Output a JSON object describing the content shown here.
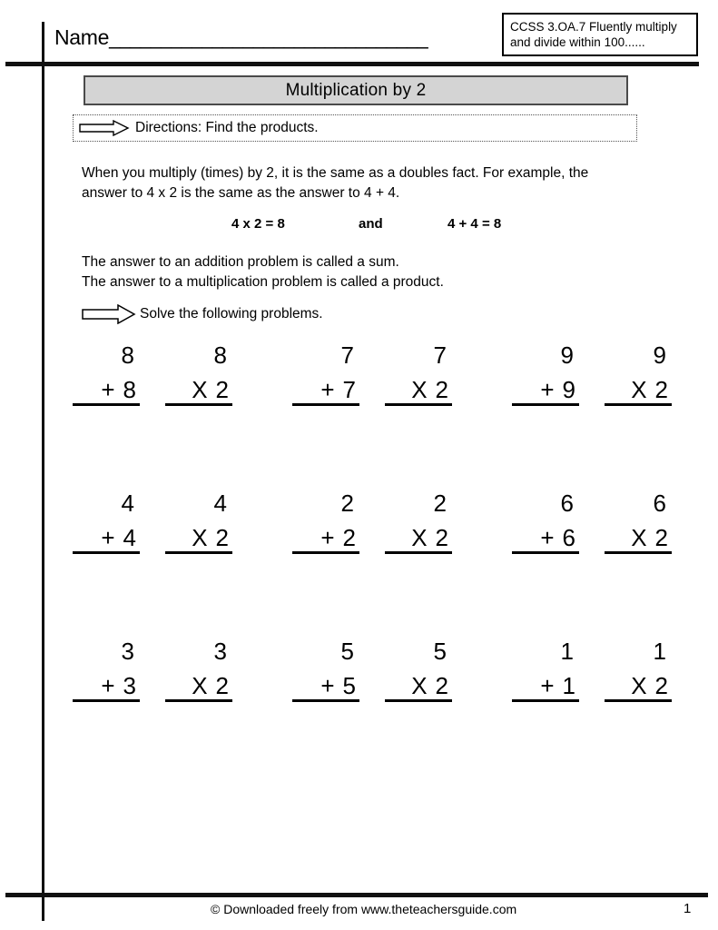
{
  "header": {
    "name_label": "Name",
    "name_blank": "_______________________________",
    "ccss_text": "CCSS 3.OA.7 Fluently multiply and divide   within 100......"
  },
  "title": {
    "banner": "Multiplication by 2"
  },
  "directions": {
    "arrow_icon": "right-arrow-icon",
    "text": "Directions: Find the products."
  },
  "lesson": {
    "intro": "When you multiply (times) by 2, it is the same as a doubles fact.  For example, the\nanswer to 4 x 2  is the same as the answer to 4 + 4.",
    "example_left": "4 x 2 = 8",
    "example_and": "and",
    "example_right": "4 + 4 = 8",
    "definitions": "The answer to an addition problem is called a sum.\nThe answer to a multiplication problem is called a product.",
    "solve_arrow_icon": "right-arrow-icon",
    "solve_text": "Solve the following problems."
  },
  "problems": {
    "rows": [
      {
        "pairs": [
          {
            "addition": {
              "top": "8",
              "op": "+",
              "bottom": "8"
            },
            "multiplication": {
              "top": "8",
              "op": "X",
              "bottom": "2"
            }
          },
          {
            "addition": {
              "top": "7",
              "op": "+",
              "bottom": "7"
            },
            "multiplication": {
              "top": "7",
              "op": "X",
              "bottom": "2"
            }
          },
          {
            "addition": {
              "top": "9",
              "op": "+",
              "bottom": "9"
            },
            "multiplication": {
              "top": "9",
              "op": "X",
              "bottom": "2"
            }
          }
        ]
      },
      {
        "pairs": [
          {
            "addition": {
              "top": "4",
              "op": "+",
              "bottom": "4"
            },
            "multiplication": {
              "top": "4",
              "op": "X",
              "bottom": "2"
            }
          },
          {
            "addition": {
              "top": "2",
              "op": "+",
              "bottom": "2"
            },
            "multiplication": {
              "top": "2",
              "op": "X",
              "bottom": "2"
            }
          },
          {
            "addition": {
              "top": "6",
              "op": "+",
              "bottom": "6"
            },
            "multiplication": {
              "top": "6",
              "op": "X",
              "bottom": "2"
            }
          }
        ]
      },
      {
        "pairs": [
          {
            "addition": {
              "top": "3",
              "op": "+",
              "bottom": "3"
            },
            "multiplication": {
              "top": "3",
              "op": "X",
              "bottom": "2"
            }
          },
          {
            "addition": {
              "top": "5",
              "op": "+",
              "bottom": "5"
            },
            "multiplication": {
              "top": "5",
              "op": "X",
              "bottom": "2"
            }
          },
          {
            "addition": {
              "top": "1",
              "op": "+",
              "bottom": "1"
            },
            "multiplication": {
              "top": "1",
              "op": "X",
              "bottom": "2"
            }
          }
        ]
      }
    ]
  },
  "footer": {
    "credit": "© Downloaded freely from www.theteachersguide.com",
    "page_number": "1"
  }
}
